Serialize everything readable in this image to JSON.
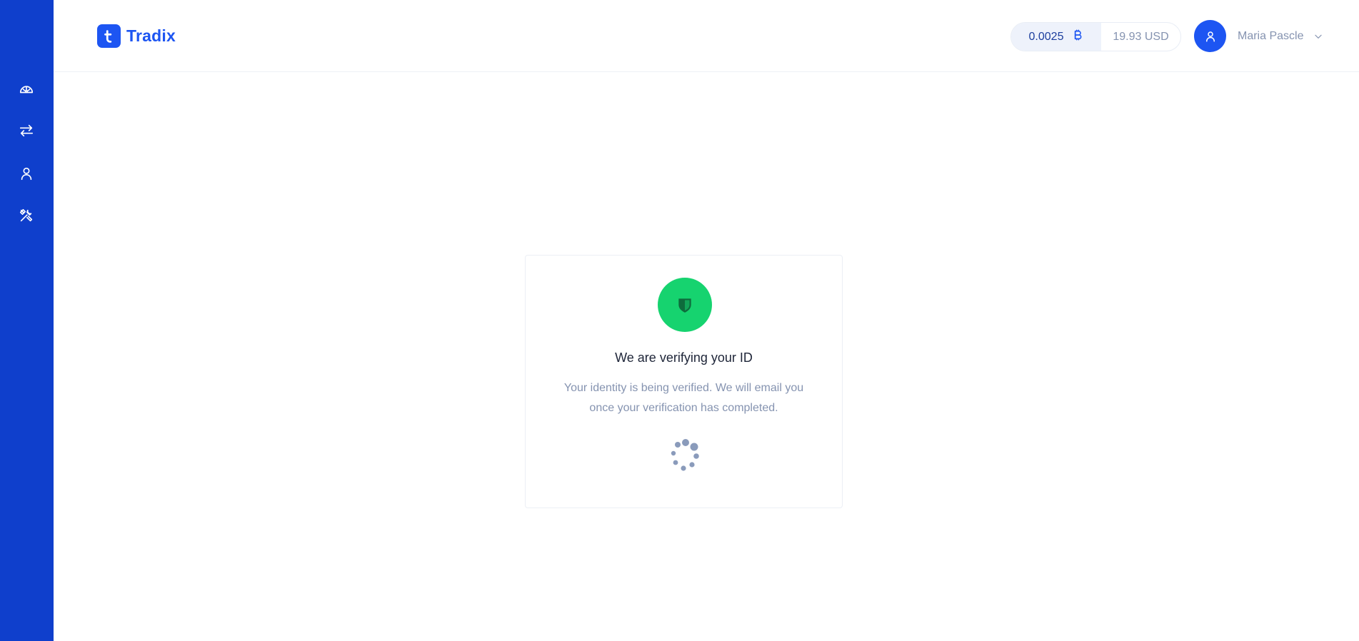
{
  "app": {
    "brand": "Tradix",
    "accent": "#1d55f2",
    "sidebar_color": "#0f3fcc"
  },
  "sidebar": {
    "items": [
      {
        "icon": "dashboard-icon"
      },
      {
        "icon": "exchange-icon"
      },
      {
        "icon": "user-icon"
      },
      {
        "icon": "tools-icon"
      }
    ]
  },
  "header": {
    "balance_btc": "0.0025",
    "btc_icon": "bitcoin-icon",
    "balance_usd": "19.93 USD",
    "user_name": "Maria Pascle"
  },
  "verification": {
    "title": "We are verifying your ID",
    "message": "Your identity is being verified. We will email you once your verification has completed.",
    "status_color": "#16d36f"
  }
}
